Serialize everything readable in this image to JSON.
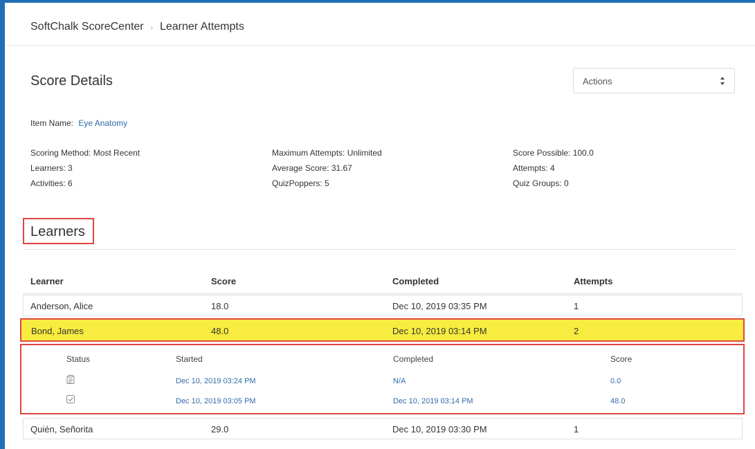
{
  "breadcrumb": {
    "root": "SoftChalk ScoreCenter",
    "separator": "›",
    "current": "Learner Attempts"
  },
  "page_title": "Score Details",
  "actions_select": {
    "value": "Actions"
  },
  "item": {
    "label": "Item Name:",
    "value": "Eye Anatomy"
  },
  "stats": {
    "scoring_method": "Scoring Method: Most Recent",
    "learners": "Learners: 3",
    "activities": "Activities:  6",
    "maximum_attempts": "Maximum Attempts: Unlimited",
    "average_score": "Average Score: 31.67",
    "quizpoppers": "QuizPoppers:  5",
    "score_possible": "Score Possible: 100.0",
    "attempts": "Attempts: 4",
    "quiz_groups": "Quiz Groups:  0"
  },
  "learners_heading": "Learners",
  "table": {
    "headers": [
      "Learner",
      "Score",
      "Completed",
      "Attempts"
    ],
    "rows": [
      {
        "learner": "Anderson, Alice",
        "score": "18.0",
        "completed": "Dec 10, 2019 03:35 PM",
        "attempts": "1"
      },
      {
        "learner": "Bond, James",
        "score": "48.0",
        "completed": "Dec 10, 2019 03:14 PM",
        "attempts": "2"
      },
      {
        "learner": "Quién, Señorita",
        "score": "29.0",
        "completed": "Dec 10, 2019 03:30 PM",
        "attempts": "1"
      }
    ]
  },
  "attempt_details": {
    "headers": [
      "Status",
      "Started",
      "Completed",
      "Score"
    ],
    "rows": [
      {
        "status_icon": "in-progress-icon",
        "started": "Dec 10, 2019 03:24 PM",
        "completed": "N/A",
        "score": "0.0"
      },
      {
        "status_icon": "completed-check-icon",
        "started": "Dec 10, 2019 03:05 PM",
        "completed": "Dec 10, 2019 03:14 PM",
        "score": "48.0"
      }
    ]
  },
  "colors": {
    "frame": "#1f6fb5",
    "highlight": "#f7ec3f",
    "annotation": "#e0453f",
    "link": "#2f6ba8"
  }
}
